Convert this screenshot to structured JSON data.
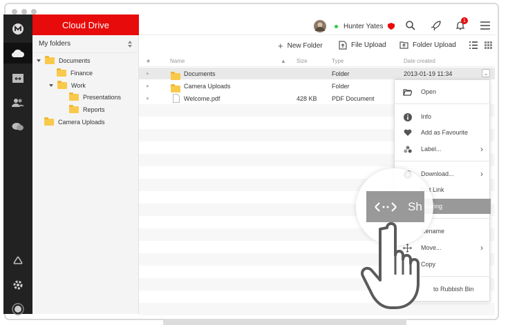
{
  "window": {
    "brand": "Cloud Drive"
  },
  "user": {
    "name": "Hunter Yates",
    "notifications": "1"
  },
  "sidebar": {
    "heading": "My folders",
    "tree": [
      {
        "label": "Documents",
        "level": 0,
        "expanded": true
      },
      {
        "label": "Finance",
        "level": 1
      },
      {
        "label": "Work",
        "level": 1,
        "expanded": true
      },
      {
        "label": "Presentations",
        "level": 2
      },
      {
        "label": "Reports",
        "level": 2
      },
      {
        "label": "Camera Uploads",
        "level": 0,
        "special": true
      }
    ]
  },
  "toolbar": {
    "new_folder": "New Folder",
    "file_upload": "File Upload",
    "folder_upload": "Folder Upload"
  },
  "columns": {
    "name": "Name",
    "size": "Size",
    "type": "Type",
    "date": "Date created"
  },
  "files": [
    {
      "name": "Documents",
      "size": "",
      "type": "Folder",
      "date": "2013-01-19 11:34",
      "kind": "folder"
    },
    {
      "name": "Camera Uploads",
      "size": "",
      "type": "Folder",
      "date": "",
      "kind": "camera"
    },
    {
      "name": "Welcome.pdf",
      "size": "428 KB",
      "type": "PDF Document",
      "date": "",
      "kind": "pdf"
    }
  ],
  "context_menu": {
    "open": "Open",
    "info": "Info",
    "favourite": "Add as Favourite",
    "label": "Label...",
    "download": "Download...",
    "get_link": "Get Link",
    "sharing": "Sharing",
    "rename": "Rename",
    "move": "Move...",
    "copy": "Copy",
    "rubbish": "to Rubbish Bin"
  },
  "magnifier": {
    "text": "Sh"
  },
  "colors": {
    "brand": "#e80b0b",
    "highlight": "#999999",
    "online": "#2ecc40",
    "rail": "#222222"
  }
}
